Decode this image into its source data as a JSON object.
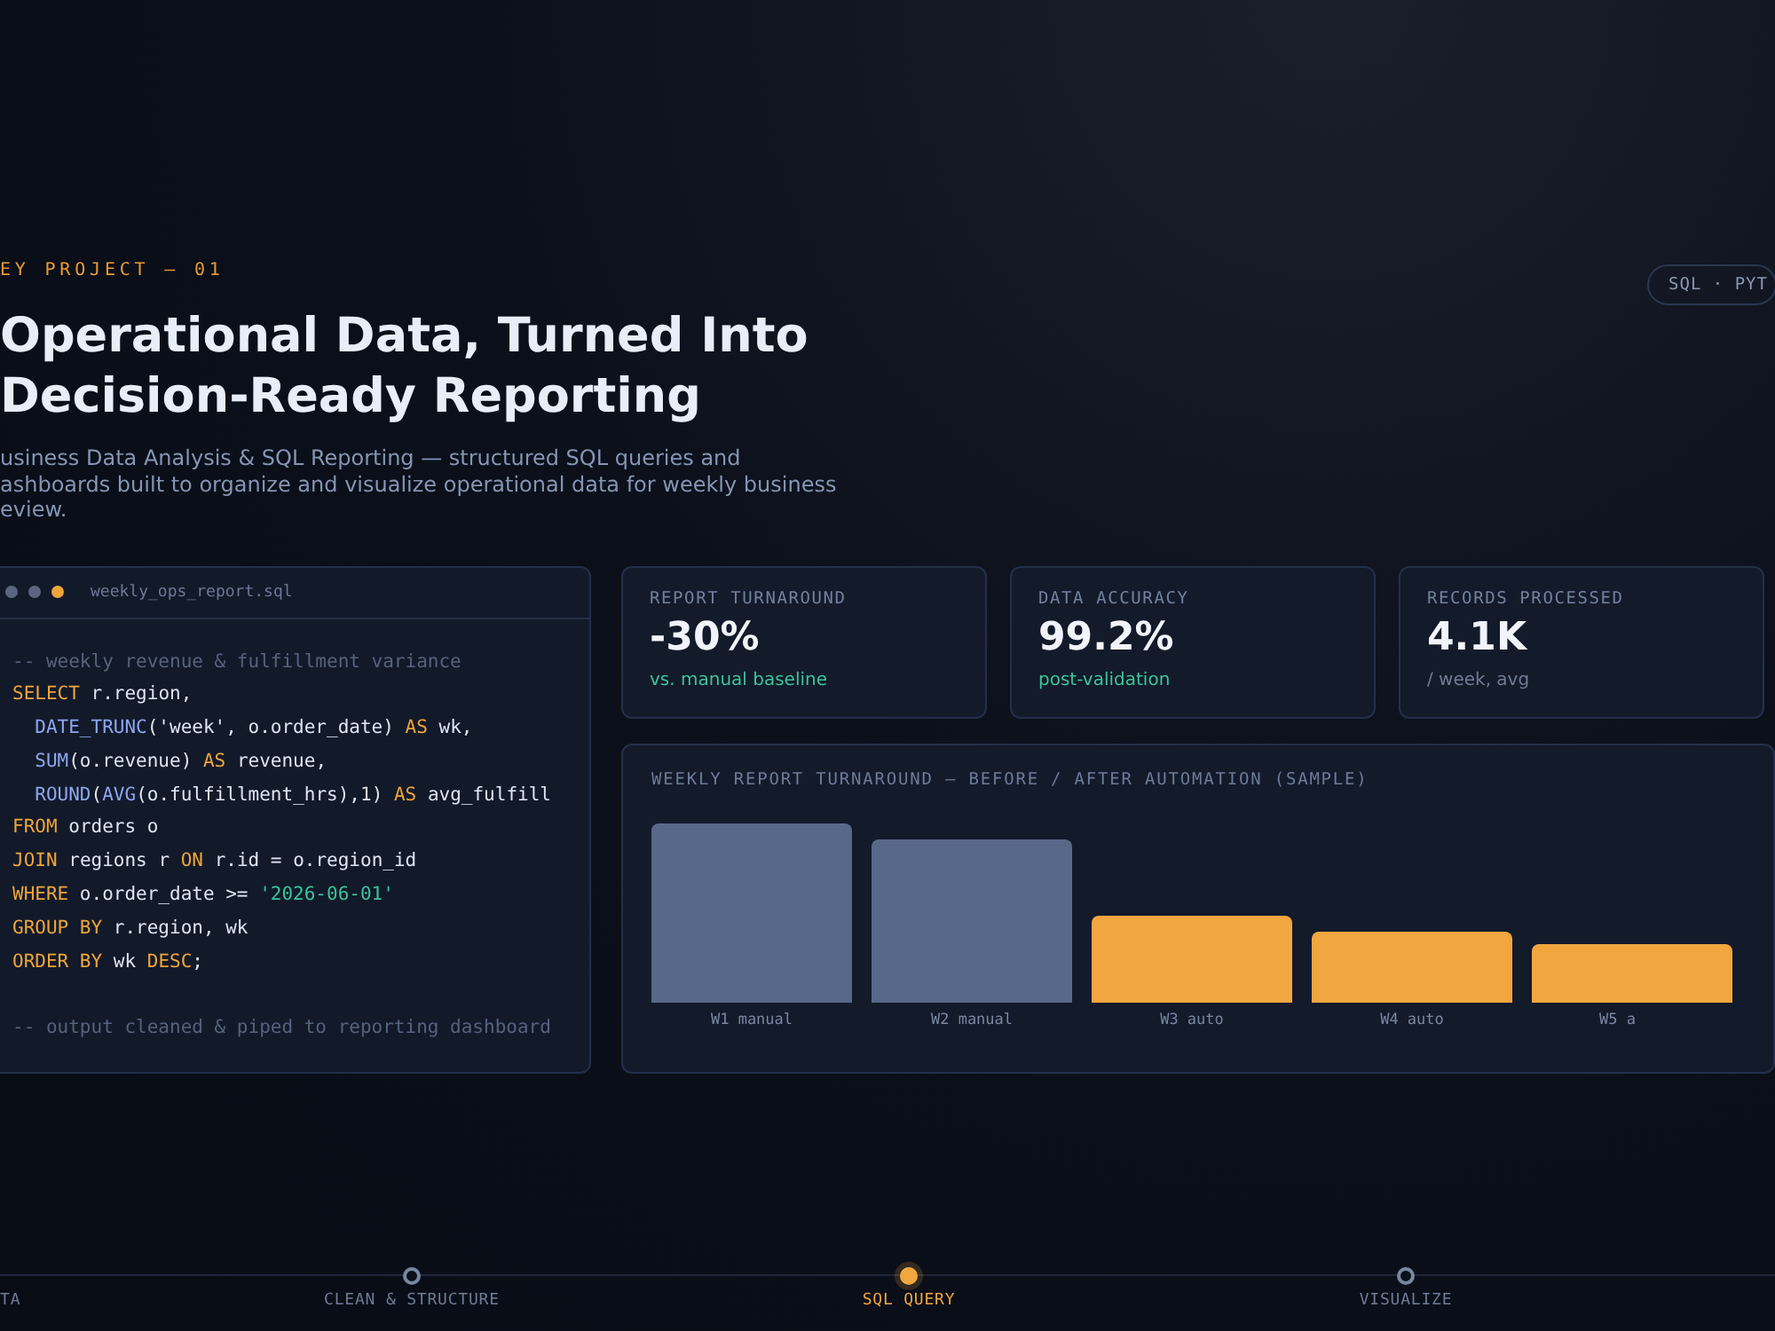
{
  "eyebrow": "EY PROJECT — 01",
  "title_lines": [
    "Operational Data, Turned Into",
    "Decision-Ready Reporting"
  ],
  "description_lines": [
    "usiness Data Analysis & SQL Reporting — structured SQL queries and",
    "ashboards built to organize and visualize operational data for weekly business",
    "eview."
  ],
  "tag": "SQL · PYT",
  "code_window": {
    "filename": "weekly_ops_report.sql",
    "lines": [
      {
        "kind": "code",
        "tokens": [
          {
            "kind": "comment",
            "text": "-- weekly revenue & fulfillment variance"
          }
        ]
      },
      {
        "kind": "code",
        "tokens": [
          {
            "kind": "keyword",
            "text": "SELECT"
          },
          {
            "kind": "plain",
            "text": " r.region,"
          }
        ]
      },
      {
        "kind": "code",
        "tokens": [
          {
            "kind": "function",
            "text": "  DATE_TRUNC"
          },
          {
            "kind": "plain",
            "text": "('week', o.order_date) "
          },
          {
            "kind": "keyword",
            "text": "AS"
          },
          {
            "kind": "plain",
            "text": " wk,"
          }
        ]
      },
      {
        "kind": "code",
        "tokens": [
          {
            "kind": "function",
            "text": "  SUM"
          },
          {
            "kind": "plain",
            "text": "(o.revenue) "
          },
          {
            "kind": "keyword",
            "text": "AS"
          },
          {
            "kind": "plain",
            "text": " revenue,"
          }
        ]
      },
      {
        "kind": "code",
        "tokens": [
          {
            "kind": "function",
            "text": "  ROUND"
          },
          {
            "kind": "plain",
            "text": "("
          },
          {
            "kind": "function",
            "text": "AVG"
          },
          {
            "kind": "plain",
            "text": "(o.fulfillment_hrs),1) "
          },
          {
            "kind": "keyword",
            "text": "AS"
          },
          {
            "kind": "plain",
            "text": " avg_fulfill"
          }
        ]
      },
      {
        "kind": "code",
        "tokens": [
          {
            "kind": "keyword",
            "text": "FROM"
          },
          {
            "kind": "plain",
            "text": " orders o"
          }
        ]
      },
      {
        "kind": "code",
        "tokens": [
          {
            "kind": "keyword",
            "text": "JOIN"
          },
          {
            "kind": "plain",
            "text": " regions r "
          },
          {
            "kind": "keyword",
            "text": "ON"
          },
          {
            "kind": "plain",
            "text": " r.id = o.region_id"
          }
        ]
      },
      {
        "kind": "code",
        "tokens": [
          {
            "kind": "keyword",
            "text": "WHERE"
          },
          {
            "kind": "plain",
            "text": " o.order_date >= "
          },
          {
            "kind": "string",
            "text": "'2026-06-01'"
          }
        ]
      },
      {
        "kind": "code",
        "tokens": [
          {
            "kind": "keyword",
            "text": "GROUP BY"
          },
          {
            "kind": "plain",
            "text": " r.region, wk"
          }
        ]
      },
      {
        "kind": "code",
        "tokens": [
          {
            "kind": "keyword",
            "text": "ORDER BY"
          },
          {
            "kind": "plain",
            "text": " wk "
          },
          {
            "kind": "keyword",
            "text": "DESC"
          },
          {
            "kind": "plain",
            "text": ";"
          }
        ]
      },
      {
        "kind": "blank"
      },
      {
        "kind": "code",
        "tokens": [
          {
            "kind": "comment",
            "text": "-- output cleaned & piped to reporting dashboard"
          }
        ]
      }
    ]
  },
  "metrics": [
    {
      "label": "REPORT TURNAROUND",
      "value": "-30%",
      "note": "vs. manual baseline",
      "kind": "positive"
    },
    {
      "label": "DATA ACCURACY",
      "value": "99.2%",
      "note": "post-validation",
      "kind": "positive"
    },
    {
      "label": "RECORDS PROCESSED",
      "value": "4.1K",
      "note": "/ week, avg",
      "kind": "neutral"
    }
  ],
  "turnaround_chart": {
    "title": "WEEKLY REPORT TURNAROUND — BEFORE / AFTER AUTOMATION (SAMPLE)",
    "bars": [
      {
        "label": "W1 manual",
        "kind": "manual"
      },
      {
        "label": "W2 manual",
        "kind": "manual"
      },
      {
        "label": "W3 auto",
        "kind": "auto"
      },
      {
        "label": "W4 auto",
        "kind": "auto"
      },
      {
        "label": "W5 a",
        "kind": "auto"
      }
    ]
  },
  "steps": [
    {
      "label": "TA",
      "selected": false
    },
    {
      "label": "CLEAN & STRUCTURE",
      "selected": false
    },
    {
      "label": "SQL QUERY",
      "selected": true
    },
    {
      "label": "VISUALIZE",
      "selected": false
    }
  ]
}
